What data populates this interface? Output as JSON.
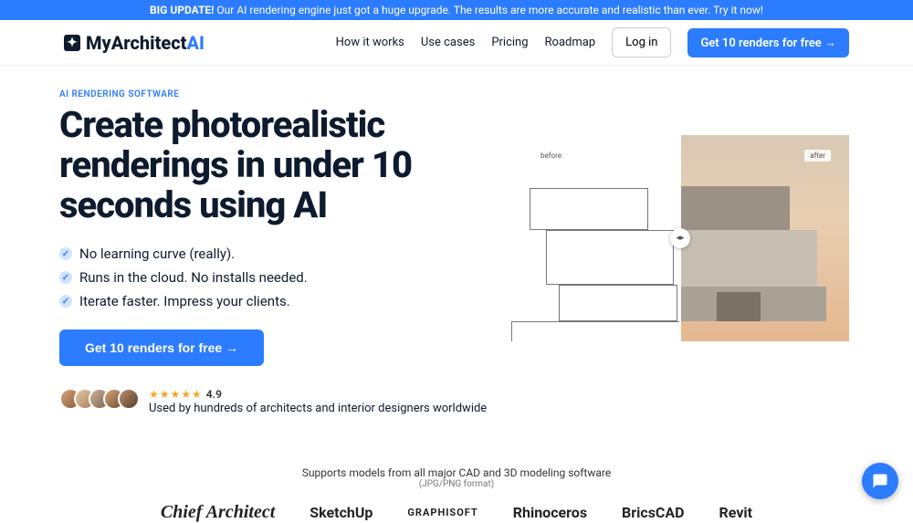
{
  "banner": {
    "bold": "BIG UPDATE!",
    "text": "Our AI rendering engine just got a huge upgrade. The results are more accurate and realistic than ever. Try it now!"
  },
  "logo": {
    "name": "MyArchitect",
    "suffix": "AI"
  },
  "nav": {
    "how": "How it works",
    "use": "Use cases",
    "pricing": "Pricing",
    "roadmap": "Roadmap",
    "login": "Log in",
    "cta": "Get 10 renders for free →"
  },
  "hero": {
    "eyebrow": "AI RENDERING SOFTWARE",
    "title": "Create photorealistic renderings in under 10 seconds using AI",
    "bullets": [
      "No learning curve (really).",
      "Runs in the cloud. No installs needed.",
      "Iterate faster. Impress your clients."
    ],
    "cta": "Get 10 renders for free →",
    "rating": "4.9",
    "social": "Used by hundreds of architects and interior designers worldwide"
  },
  "comparison": {
    "before": "before",
    "after": "after"
  },
  "supports": {
    "line": "Supports models from all major CAD and 3D modeling software",
    "sub": "(JPG/PNG format)"
  },
  "logos": [
    "Chief Architect",
    "SketchUp",
    "GRAPHISOFT",
    "Rhinoceros",
    "BricsCAD",
    "Revit"
  ]
}
